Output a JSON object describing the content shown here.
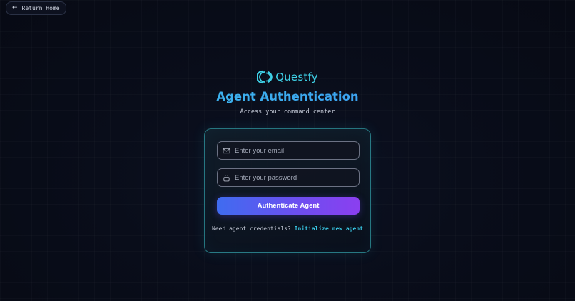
{
  "nav": {
    "back_label": "Return Home",
    "back_icon": "arrow-left-icon"
  },
  "brand": {
    "name": "Questfy",
    "logo_icon": "questfy-logo-icon",
    "color": "#3fd2e8"
  },
  "header": {
    "title": "Agent Authentication",
    "subtitle": "Access your command center"
  },
  "form": {
    "email": {
      "placeholder": "Enter your email",
      "value": "",
      "icon": "mail-icon"
    },
    "password": {
      "placeholder": "Enter your password",
      "value": "",
      "icon": "lock-icon"
    },
    "submit_label": "Authenticate Agent"
  },
  "footer": {
    "prompt": "Need agent credentials?",
    "link_label": "Initialize new agent"
  },
  "colors": {
    "accent_cyan": "#38c3e0",
    "button_gradient_start": "#3f6cf0",
    "button_gradient_end": "#8b3ff0",
    "card_border": "#3cc8d2"
  }
}
